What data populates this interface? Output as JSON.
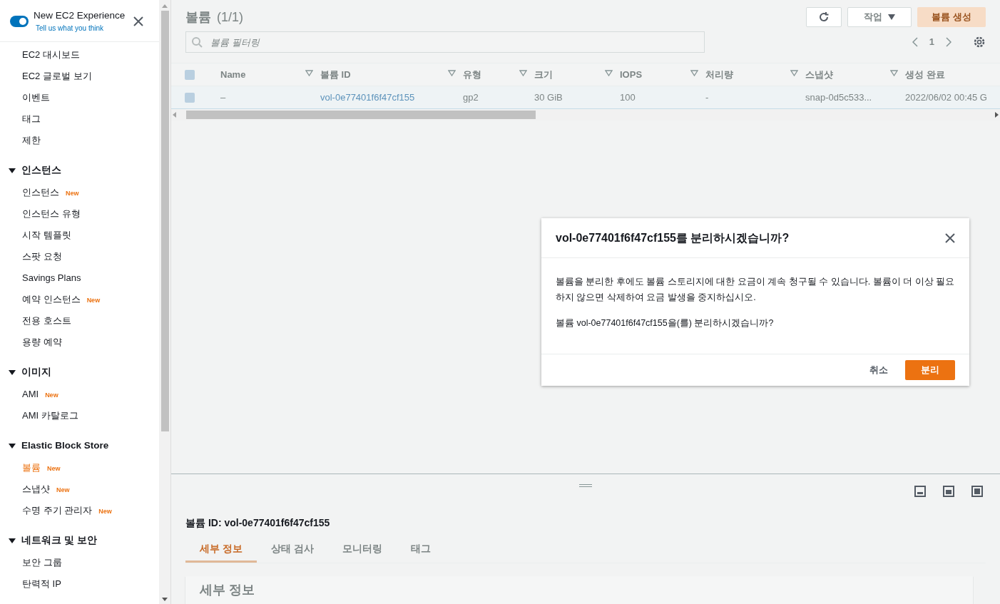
{
  "experience": {
    "label": "New EC2 Experience",
    "link": "Tell us what you think",
    "on": true
  },
  "sidebar": {
    "items": [
      {
        "label": "EC2 대시보드",
        "selected": false
      },
      {
        "label": "EC2 글로벌 보기",
        "selected": false
      },
      {
        "label": "이벤트",
        "selected": false
      },
      {
        "label": "태그",
        "selected": false
      },
      {
        "label": "제한",
        "selected": false
      }
    ],
    "sections": [
      {
        "title": "인스턴스",
        "expanded": true,
        "items": [
          {
            "label": "인스턴스",
            "badge": "New",
            "selected": false
          },
          {
            "label": "인스턴스 유형",
            "selected": false
          },
          {
            "label": "시작 템플릿",
            "selected": false
          },
          {
            "label": "스팟 요청",
            "selected": false
          },
          {
            "label": "Savings Plans",
            "selected": false
          },
          {
            "label": "예약 인스턴스",
            "badge": "New",
            "selected": false
          },
          {
            "label": "전용 호스트",
            "selected": false
          },
          {
            "label": "용량 예약",
            "selected": false
          }
        ]
      },
      {
        "title": "이미지",
        "expanded": true,
        "items": [
          {
            "label": "AMI",
            "badge": "New",
            "selected": false
          },
          {
            "label": "AMI 카탈로그",
            "selected": false
          }
        ]
      },
      {
        "title": "Elastic Block Store",
        "expanded": true,
        "items": [
          {
            "label": "볼륨",
            "badge": "New",
            "selected": true
          },
          {
            "label": "스냅샷",
            "badge": "New",
            "selected": false
          },
          {
            "label": "수명 주기 관리자",
            "badge": "New",
            "selected": false
          }
        ]
      },
      {
        "title": "네트워크 및 보안",
        "expanded": true,
        "items": [
          {
            "label": "보안 그룹",
            "selected": false
          },
          {
            "label": "탄력적 IP",
            "selected": false
          }
        ]
      }
    ]
  },
  "main": {
    "title": "볼륨",
    "count": "(1/1)",
    "actions": "작업",
    "create": "볼륨 생성",
    "filter": {
      "placeholder": "볼륨 필터링"
    },
    "page": "1",
    "table": {
      "all_checked": true,
      "columns": [
        "Name",
        "볼륨 ID",
        "유형",
        "크기",
        "IOPS",
        "처리량",
        "스냅샷",
        "생성 완료"
      ],
      "rows": [
        {
          "checked": true,
          "cells": [
            "–",
            "vol-0e77401f6f47cf155",
            "gp2",
            "30 GiB",
            "100",
            "-",
            "snap-0d5c533...",
            "2022/06/02 00:45 G"
          ]
        }
      ]
    },
    "detail": {
      "title": "볼륨 ID: vol-0e77401f6f47cf155",
      "tabs": [
        {
          "label": "세부 정보",
          "selected": true
        },
        {
          "label": "상태 검사",
          "selected": false
        },
        {
          "label": "모니터링",
          "selected": false
        },
        {
          "label": "태그",
          "selected": false
        }
      ],
      "heading": "세부 정보"
    }
  },
  "modal": {
    "title": "vol-0e77401f6f47cf155를 분리하시겠습니까?",
    "paragraphs": [
      "볼륨을 분리한 후에도 볼륨 스토리지에 대한 요금이 계속 청구될 수 있습니다. 볼륨이 더 이상 필요하지 않으면 삭제하여 요금 발생을 중지하십시오.",
      "볼륨 vol-0e77401f6f47cf155을(를) 분리하시겠습니까?"
    ],
    "cancel": "취소",
    "confirm": "분리"
  }
}
